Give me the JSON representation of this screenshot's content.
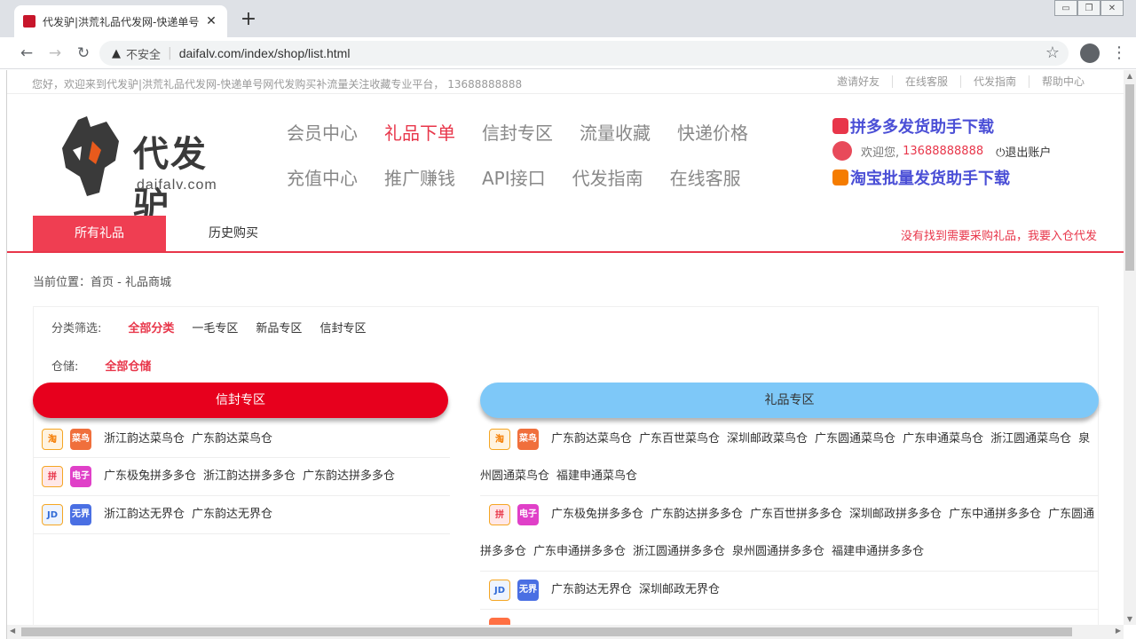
{
  "browser": {
    "tab_title": "代发驴|洪荒礼品代发网-快递单号",
    "tab_close": "✕",
    "new_tab": "+",
    "insecure_label": "不安全",
    "url": "daifalv.com/index/shop/list.html",
    "back_icon": "←",
    "forward_icon": "→",
    "reload_icon": "↻",
    "star_icon": "☆",
    "menu_icon": "⋮",
    "warn_icon": "▲",
    "min_icon": "▭",
    "max_icon": "❐",
    "close_icon": "✕"
  },
  "topbar": {
    "welcome": "您好，欢迎来到代发驴|洪荒礼品代发网-快递单号网代发购买补流量关注收藏专业平台， 13688888888",
    "links": [
      "邀请好友",
      "在线客服",
      "代发指南",
      "帮助中心"
    ]
  },
  "logo": {
    "brand": "代发驴",
    "domain": "daifalv.com"
  },
  "nav": {
    "row1": [
      "会员中心",
      "礼品下单",
      "信封专区",
      "流量收藏",
      "快递价格"
    ],
    "row2": [
      "充值中心",
      "推广赚钱",
      "API接口",
      "代发指南",
      "在线客服"
    ],
    "active": "礼品下单"
  },
  "side": {
    "pdd_download": "拼多多发货助手下载",
    "welcome": "欢迎您,",
    "phone": "13688888888",
    "logout": "退出账户",
    "taobao_download": "淘宝批量发货助手下载"
  },
  "subnav": {
    "tab_all": "所有礼品",
    "tab_history": "历史购买",
    "notice": "没有找到需要采购礼品，我要入仓代发"
  },
  "breadcrumb": "当前位置：首页 - 礼品商城",
  "filter": {
    "category_label": "分类筛选:",
    "categories": [
      "全部分类",
      "一毛专区",
      "新品专区",
      "信封专区"
    ],
    "warehouse_label": "仓储:",
    "warehouse_selected": "全部仓储"
  },
  "sections": {
    "envelope": "信封专区",
    "gift": "礼品专区"
  },
  "envelope_rows": [
    {
      "badges": [
        "淘",
        "菜鸟"
      ],
      "items": [
        "浙江韵达菜鸟仓",
        "广东韵达菜鸟仓"
      ]
    },
    {
      "badges": [
        "拼",
        "电子"
      ],
      "items": [
        "广东极兔拼多多仓",
        "浙江韵达拼多多仓",
        "广东韵达拼多多仓"
      ]
    },
    {
      "badges": [
        "JD",
        "无界"
      ],
      "items": [
        "浙江韵达无界仓",
        "广东韵达无界仓"
      ]
    }
  ],
  "gift_rows": [
    {
      "badges": [
        "淘",
        "菜鸟"
      ],
      "line1": [
        "广东韵达菜鸟仓",
        "广东百世菜鸟仓",
        "深圳邮政菜鸟仓",
        "广东圆通菜鸟仓",
        "广东申通菜鸟仓",
        "浙江圆通菜鸟仓",
        "泉"
      ],
      "line2": [
        "州圆通菜鸟仓",
        "福建申通菜鸟仓"
      ]
    },
    {
      "badges": [
        "拼",
        "电子"
      ],
      "line1": [
        "广东极兔拼多多仓",
        "广东韵达拼多多仓",
        "广东百世拼多多仓",
        "深圳邮政拼多多仓",
        "广东中通拼多多仓",
        "广东圆通"
      ],
      "line2": [
        "拼多多仓",
        "广东申通拼多多仓",
        "浙江圆通拼多多仓",
        "泉州圆通拼多多仓",
        "福建申通拼多多仓"
      ]
    },
    {
      "badges": [
        "JD",
        "无界"
      ],
      "line1": [
        "广东韵达无界仓",
        "深圳邮政无界仓"
      ],
      "line2": []
    }
  ],
  "colors": {
    "accent": "#e8364a",
    "red_band": "#e7001d",
    "blue_band": "#7ec8f8",
    "link_purple": "#4b4fd6"
  }
}
